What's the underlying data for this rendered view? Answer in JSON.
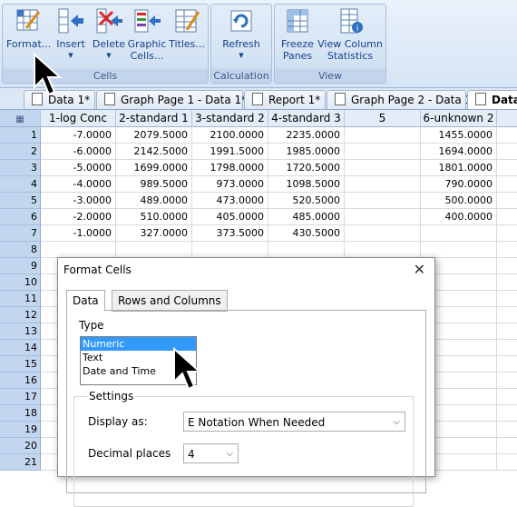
{
  "ribbon": {
    "groups": {
      "cells": "Cells",
      "calculation": "Calculation",
      "view": "View"
    },
    "buttons": {
      "format": "Format...",
      "insert": "Insert",
      "delete": "Delete",
      "graphic_cells_1": "Graphic",
      "graphic_cells_2": "Cells...",
      "titles": "Titles...",
      "refresh": "Refresh",
      "freeze_1": "Freeze",
      "freeze_2": "Panes",
      "viewcol_1": "View Column",
      "viewcol_2": "Statistics"
    }
  },
  "tabs": [
    "Data 1*",
    "Graph Page 1 - Data 1*",
    "Report 1*",
    "Graph Page 2 - Data 1*",
    "Data"
  ],
  "grid": {
    "columns": [
      "1-log Conc",
      "2-standard 1",
      "3-standard 2",
      "4-standard 3",
      "5",
      "6-unknown 2"
    ],
    "row_numbers": [
      "1",
      "2",
      "3",
      "4",
      "5",
      "6",
      "7",
      "8",
      "9",
      "10",
      "11",
      "12",
      "13",
      "14",
      "15",
      "16",
      "17",
      "18",
      "19",
      "20",
      "21"
    ],
    "rows": [
      [
        "-7.0000",
        "2079.5000",
        "2100.0000",
        "2235.0000",
        "",
        "1455.0000"
      ],
      [
        "-6.0000",
        "2142.5000",
        "1991.5000",
        "1985.0000",
        "",
        "1694.0000"
      ],
      [
        "-5.0000",
        "1699.0000",
        "1798.0000",
        "1720.5000",
        "",
        "1801.0000"
      ],
      [
        "-4.0000",
        "989.5000",
        "973.0000",
        "1098.5000",
        "",
        "790.0000"
      ],
      [
        "-3.0000",
        "489.0000",
        "473.0000",
        "520.5000",
        "",
        "500.0000"
      ],
      [
        "-2.0000",
        "510.0000",
        "405.0000",
        "485.0000",
        "",
        "400.0000"
      ],
      [
        "-1.0000",
        "327.0000",
        "373.5000",
        "430.5000",
        "",
        ""
      ]
    ]
  },
  "dialog": {
    "title": "Format Cells",
    "tabs": [
      "Data",
      "Rows and Columns"
    ],
    "type_label": "Type",
    "type_options": [
      "Numeric",
      "Text",
      "Date and Time"
    ],
    "selected_type": "Numeric",
    "settings_label": "Settings",
    "display_as_label": "Display as:",
    "display_as_value": "E Notation When Needed",
    "decimal_places_label": "Decimal places",
    "decimal_places_value": "4"
  }
}
